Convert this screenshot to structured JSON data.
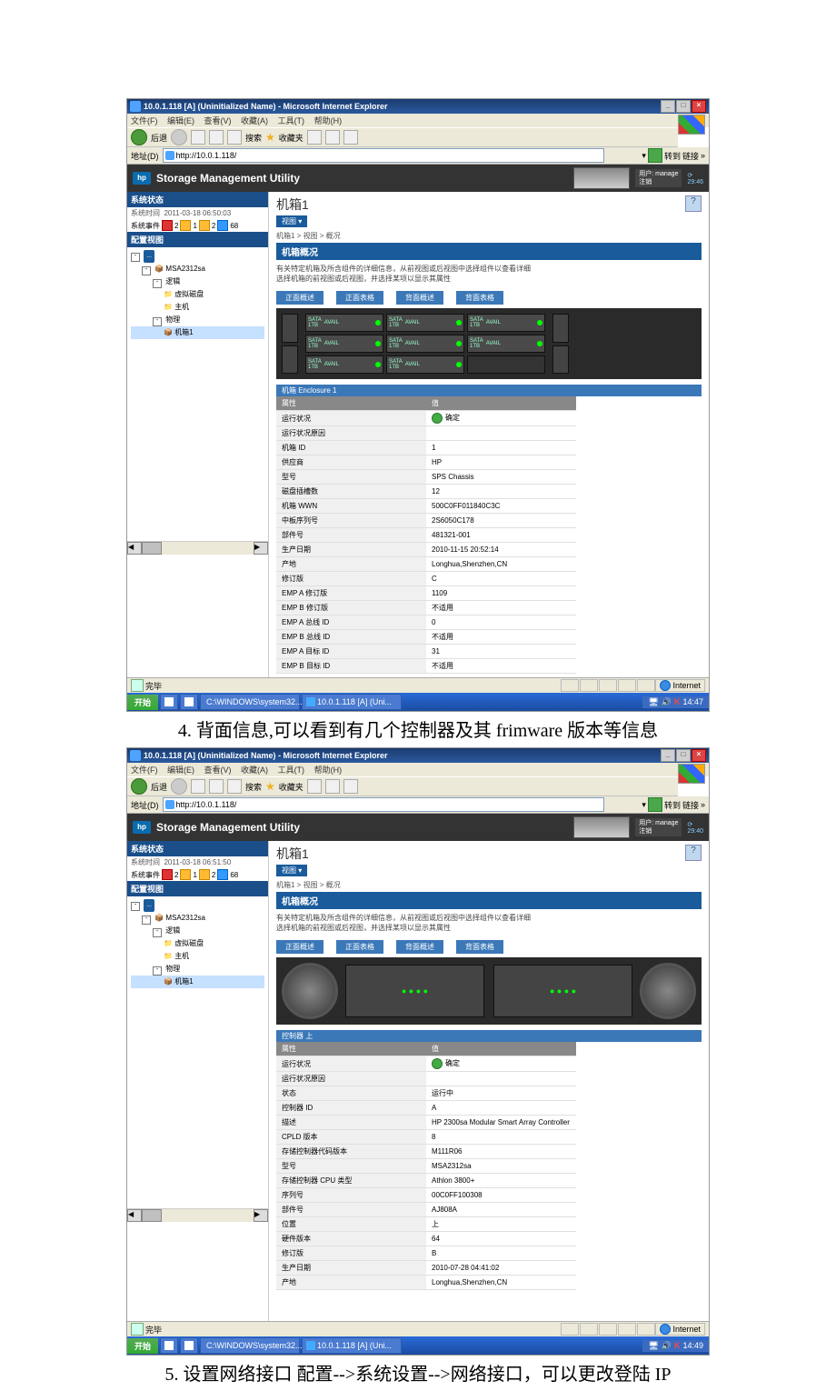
{
  "screenshot1": {
    "windowTitle": "10.0.1.118 [A] (Uninitialized Name) - Microsoft Internet Explorer",
    "menus": [
      "文件(F)",
      "编辑(E)",
      "查看(V)",
      "收藏(A)",
      "工具(T)",
      "帮助(H)"
    ],
    "toolbar": {
      "back": "后退",
      "search": "搜索",
      "fav": "收藏夹"
    },
    "addrLabel": "地址(D)",
    "url": "http://10.0.1.118/",
    "go": "转到",
    "links": "链接",
    "appTitle": "Storage Management Utility",
    "userLabel": "用户: manage",
    "logout": "注销",
    "sidebar": {
      "statusHead": "系统状态",
      "timeLabel": "系统时间",
      "time": "2011-03-18 06:50:03",
      "eventsLabel": "系统事件",
      "ev": [
        "2",
        "1",
        "2",
        "68"
      ],
      "configHead": "配置视图",
      "tree": {
        "root": "MSA2312sa",
        "logic": "逻辑",
        "vdisk": "虚拟磁盘",
        "host": "主机",
        "physical": "物理",
        "enclosure": "机箱1"
      }
    },
    "content": {
      "title": "机箱1",
      "btn": "视图 ▾",
      "crumb": "机箱1 > 视图  > 概况",
      "sectionTitle": "机箱概况",
      "desc1": "有关特定机箱及所含组件的详细信息，从前视图或后视图中选择组件以查看详细",
      "desc2": "选择机箱的前视图或后视图，并选择某项以显示其属性",
      "tabs": [
        "正面概述",
        "正面表格",
        "背面概述",
        "背面表格"
      ],
      "bayText": {
        "type": "SATA",
        "cap": "1TB",
        "st": "AVAIL"
      },
      "propTitle": "机箱 Enclosure 1",
      "propHeadAttr": "属性",
      "propHeadVal": "值",
      "ok": "确定",
      "na": "不适用",
      "rows": [
        [
          "运行状况",
          "OK"
        ],
        [
          "运行状况原因",
          ""
        ],
        [
          "机箱 ID",
          "1"
        ],
        [
          "供应商",
          "HP"
        ],
        [
          "型号",
          "SPS Chassis"
        ],
        [
          "磁盘插槽数",
          "12"
        ],
        [
          "机箱 WWN",
          "500C0FF011840C3C"
        ],
        [
          "中板序列号",
          "2S6050C178"
        ],
        [
          "部件号",
          "481321-001"
        ],
        [
          "生产日期",
          "2010-11-15 20:52:14"
        ],
        [
          "产地",
          "Longhua,Shenzhen,CN"
        ],
        [
          "修订版",
          "C"
        ],
        [
          "EMP A 修订版",
          "1109"
        ],
        [
          "EMP B 修订版",
          "不适用"
        ],
        [
          "EMP A 总线 ID",
          "0"
        ],
        [
          "EMP B 总线 ID",
          "不适用"
        ],
        [
          "EMP A 目标 ID",
          "31"
        ],
        [
          "EMP B 目标 ID",
          "不适用"
        ]
      ]
    },
    "status": {
      "done": "完毕",
      "zone": "Internet"
    },
    "taskbar": {
      "start": "开始",
      "tasks": [
        "C:\\WINDOWS\\system32...",
        "10.0.1.118 [A] (Uni..."
      ],
      "time": "14:47"
    }
  },
  "caption1": "4. 背面信息,可以看到有几个控制器及其 frimware 版本等信息",
  "screenshot2": {
    "windowTitle": "10.0.1.118 [A] (Uninitialized Name) - Microsoft Internet Explorer",
    "time": "2011-03-18 06:51:50",
    "sessionClock": "29:40",
    "content": {
      "title": "机箱1",
      "btn": "视图 ▾",
      "crumb": "机箱1 > 视图  > 概况",
      "sectionTitle": "机箱概况",
      "desc1": "有关特定机箱及所含组件的详细信息，从前视图或后视图中选择组件以查看详细",
      "desc2": "选择机箱的前视图或后视图，并选择某项以显示其属性",
      "tabs": [
        "正面概述",
        "正面表格",
        "背面概述",
        "背面表格"
      ],
      "propTitle": "控制器 上",
      "propHeadAttr": "属性",
      "propHeadVal": "值",
      "ok": "确定",
      "rows": [
        [
          "运行状况",
          "OK"
        ],
        [
          "运行状况原因",
          ""
        ],
        [
          "状态",
          "运行中"
        ],
        [
          "控制器 ID",
          "A"
        ],
        [
          "描述",
          "HP 2300sa Modular Smart Array Controller"
        ],
        [
          "CPLD 版本",
          "8"
        ],
        [
          "存储控制器代码版本",
          "M111R06"
        ],
        [
          "型号",
          "MSA2312sa"
        ],
        [
          "存储控制器 CPU 类型",
          "Athlon 3800+"
        ],
        [
          "序列号",
          "00C0FF100308"
        ],
        [
          "部件号",
          "AJ808A"
        ],
        [
          "位置",
          "上"
        ],
        [
          "硬件版本",
          "64"
        ],
        [
          "修订版",
          "B"
        ],
        [
          "生产日期",
          "2010-07-28 04:41:02"
        ],
        [
          "产地",
          "Longhua,Shenzhen,CN"
        ]
      ]
    },
    "status": {
      "done": "完毕",
      "zone": "Internet"
    },
    "taskbar": {
      "start": "开始",
      "tasks": [
        "C:\\WINDOWS\\system32...",
        "10.0.1.118 [A] (Uni..."
      ],
      "time": "14:49"
    }
  },
  "caption2": "5. 设置网络接口 配置-->系统设置-->网络接口，可以更改登陆 IP"
}
